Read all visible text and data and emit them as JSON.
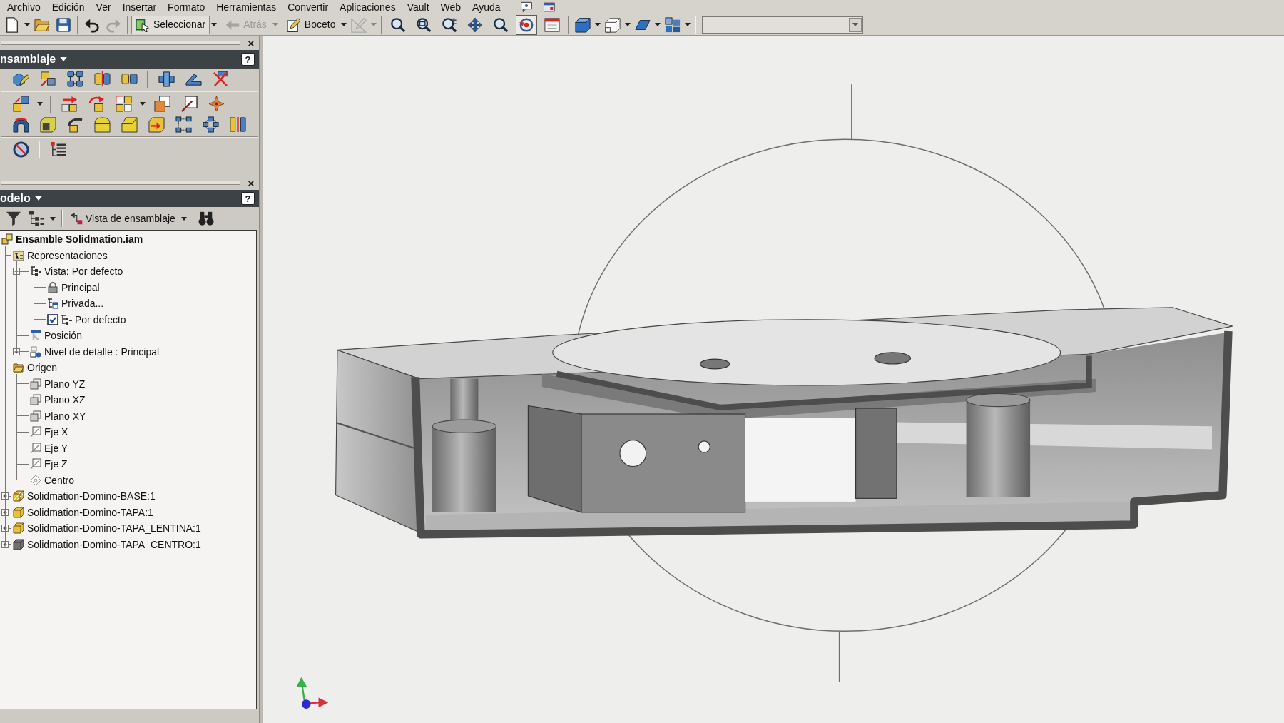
{
  "menu_bar": [
    "Archivo",
    "Edición",
    "Ver",
    "Insertar",
    "Formato",
    "Herramientas",
    "Convertir",
    "Aplicaciones",
    "Vault",
    "Web",
    "Ayuda"
  ],
  "toolbar": {
    "history": [
      {
        "disabled": false
      },
      {
        "disabled": true
      }
    ],
    "buttons": [
      {
        "label": "Seleccionar",
        "disabled": false
      },
      {
        "label": "Atrás",
        "disabled": true
      },
      {
        "label": "Boceto",
        "disabled": false
      }
    ],
    "view_tools": [
      {
        "pressed": false
      },
      {
        "pressed": false
      },
      {
        "pressed": false
      },
      {
        "pressed": false
      },
      {
        "pressed": false
      },
      {
        "pressed": true
      },
      {
        "pressed": false
      }
    ]
  },
  "panel_bar": {
    "close": "×",
    "title": "nsamblaje",
    "help": "?"
  },
  "browser": {
    "close": "×",
    "title": "odelo",
    "help": "?",
    "view_selector": "Vista de ensamblaje",
    "tree": [
      {
        "label": "Ensamble Solidmation.iam",
        "kind": "assembly",
        "children": [
          {
            "label": "Representaciones",
            "kind": "representations",
            "children": [
              {
                "label": "Vista: Por defecto",
                "kind": "view",
                "expanded": true,
                "children": [
                  {
                    "label": "Principal",
                    "kind": "lock"
                  },
                  {
                    "label": "Privada...",
                    "kind": "private"
                  },
                  {
                    "label": "Por defecto",
                    "kind": "view",
                    "checked": true
                  }
                ]
              },
              {
                "label": "Posición",
                "kind": "position"
              },
              {
                "label": "Nivel de detalle : Principal",
                "kind": "detail",
                "expanded": false
              }
            ]
          },
          {
            "label": "Origen",
            "kind": "folder",
            "children": [
              {
                "label": "Plano YZ",
                "kind": "plane"
              },
              {
                "label": "Plano XZ",
                "kind": "plane"
              },
              {
                "label": "Plano XY",
                "kind": "plane"
              },
              {
                "label": "Eje X",
                "kind": "axis"
              },
              {
                "label": "Eje Y",
                "kind": "axis"
              },
              {
                "label": "Eje Z",
                "kind": "axis"
              },
              {
                "label": "Centro",
                "kind": "point"
              }
            ]
          },
          {
            "label": "Solidmation-Domino-BASE:1",
            "kind": "adaptive",
            "expanded": false
          },
          {
            "label": "Solidmation-Domino-TAPA:1",
            "kind": "part",
            "expanded": false
          },
          {
            "label": "Solidmation-Domino-TAPA_LENTINA:1",
            "kind": "part",
            "expanded": false
          },
          {
            "label": "Solidmation-Domino-TAPA_CENTRO:1",
            "kind": "inactive",
            "expanded": false
          }
        ]
      }
    ]
  }
}
